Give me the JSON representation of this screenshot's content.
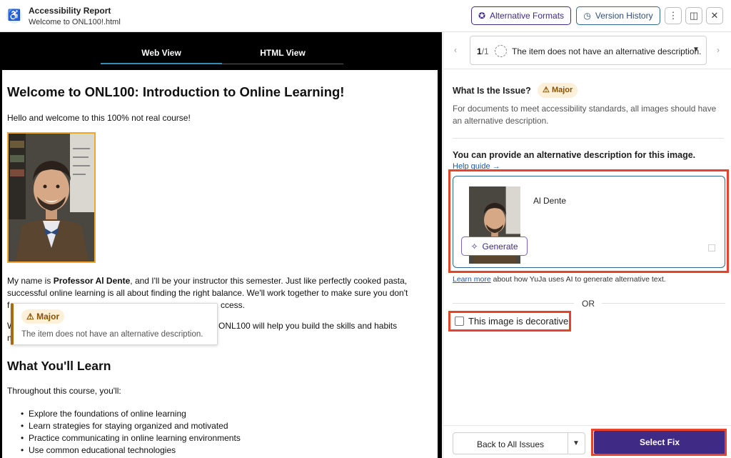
{
  "header": {
    "title": "Accessibility Report",
    "filename": "Welcome to ONL100!.html",
    "alt_formats_label": "Alternative Formats",
    "version_history_label": "Version History"
  },
  "view_tabs": [
    {
      "label": "Web View",
      "active": true
    },
    {
      "label": "HTML View",
      "active": false
    }
  ],
  "document": {
    "heading": "Welcome to ONL100: Introduction to Online Learning!",
    "intro": "Hello and welcome to this 100% not real course!",
    "para1_line1_prefix": "My name is ",
    "para1_line1_bold": "Professor Al Dente",
    "para1_line1_suffix": ", and I'll be your instructor this semester. Just like perfectly cooked pasta,",
    "para1_line2": "successful online learning is all about finding the right balance. We'll work together to make sure you don't",
    "para1_line3_start": "f",
    "para1_line3_end": "ccess.",
    "para2_line1_start": "W",
    "para2_line1_end": "ONL100 will help you build the skills and habits",
    "para2_line2_start": "n",
    "section_heading": "What You'll Learn",
    "section_intro": "Throughout this course, you'll:",
    "bullets": [
      "Explore the foundations of online learning",
      "Learn strategies for staying organized and motivated",
      "Practice communicating in online learning environments",
      "Use common educational technologies"
    ]
  },
  "tooltip": {
    "severity": "Major",
    "message": "The item does not have an alternative description."
  },
  "issue_nav": {
    "current": "1",
    "total": "/1",
    "label": "The item does not have an alternative description."
  },
  "issue": {
    "title": "What Is the Issue?",
    "severity": "Major",
    "description": "For documents to meet accessibility standards, all images should have an alternative description."
  },
  "fix": {
    "title": "You can provide an alternative description for this image.",
    "help_link": "Help guide →",
    "alt_text_value": "Al Dente",
    "generate_label": "Generate",
    "learn_more_link": "Learn more",
    "learn_more_text": " about how YuJa uses AI to generate alternative text.",
    "or_label": "OR",
    "decorative_label": "This image is decorative.",
    "decorative_checked": false
  },
  "footer": {
    "back_label": "Back to All Issues",
    "select_fix_label": "Select Fix"
  },
  "colors": {
    "brand_purple": "#3f2a86",
    "highlight_red": "#e8432a",
    "major_bg": "#fdf0d9",
    "image_border": "#f2a72c"
  }
}
